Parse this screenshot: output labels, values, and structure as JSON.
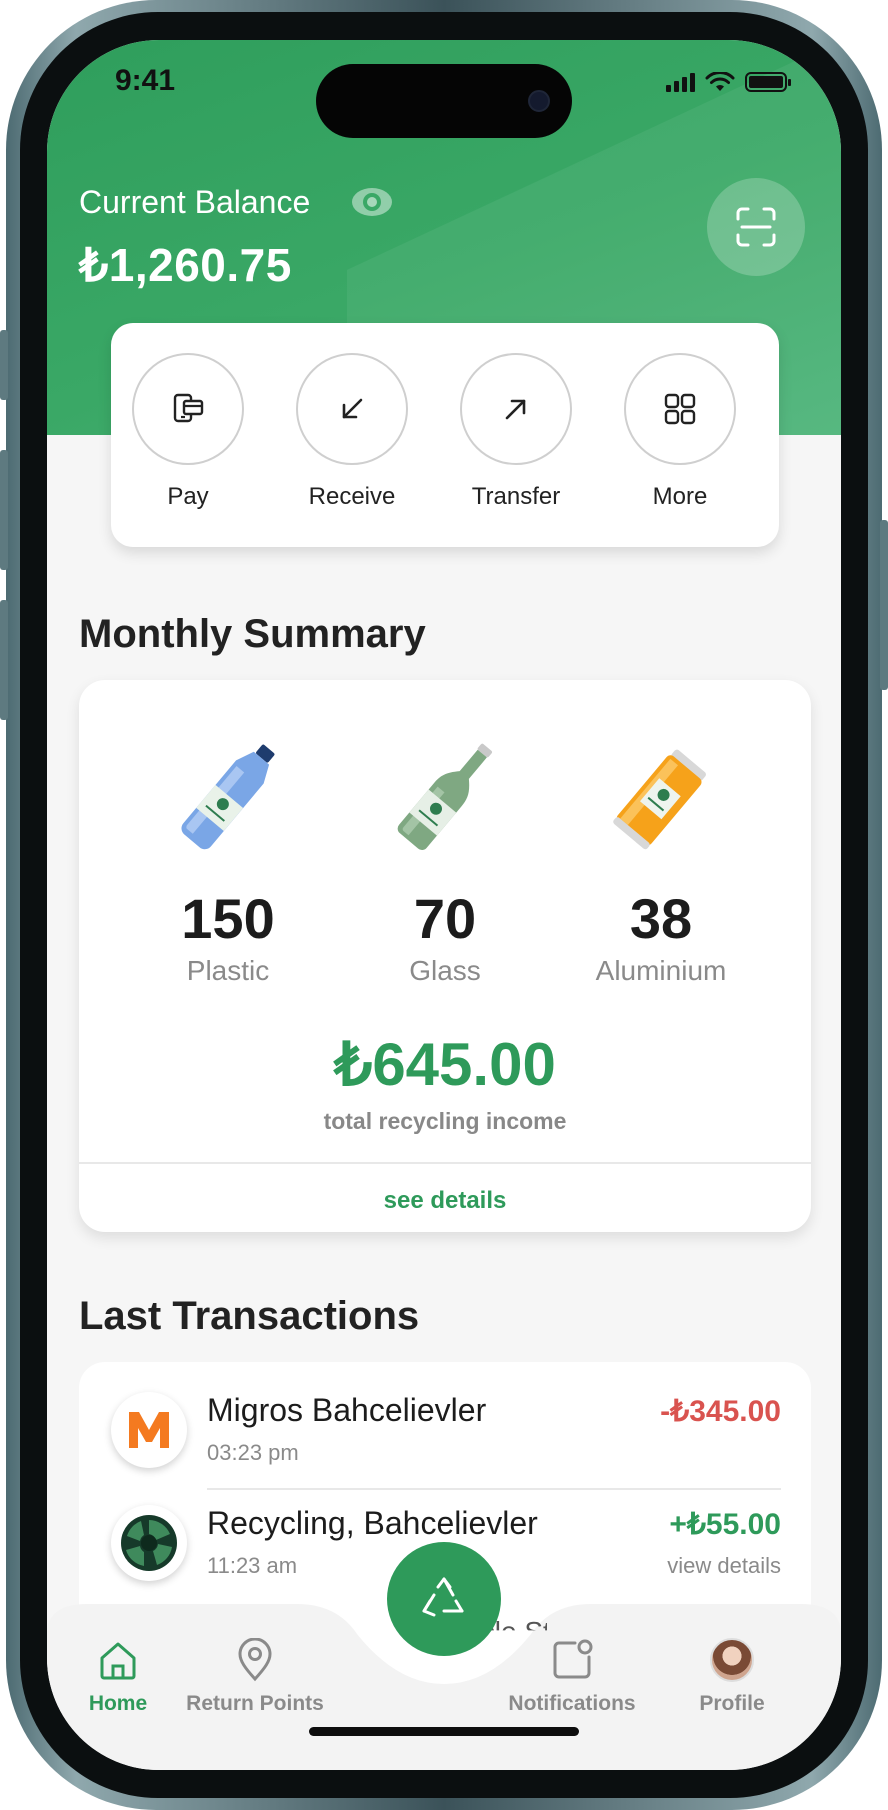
{
  "status": {
    "time": "9:41"
  },
  "balance": {
    "label": "Current Balance",
    "amount": "₺1,260.75"
  },
  "actions": [
    {
      "label": "Pay",
      "icon": "pay-icon"
    },
    {
      "label": "Receive",
      "icon": "arrow-down-left-icon"
    },
    {
      "label": "Transfer",
      "icon": "arrow-up-right-icon"
    },
    {
      "label": "More",
      "icon": "grid-icon"
    }
  ],
  "summary": {
    "title": "Monthly Summary",
    "materials": [
      {
        "count": "150",
        "name": "Plastic",
        "icon": "plastic-bottle-icon",
        "color": "#6e9de0"
      },
      {
        "count": "70",
        "name": "Glass",
        "icon": "glass-bottle-icon",
        "color": "#7fa882"
      },
      {
        "count": "38",
        "name": "Aluminium",
        "icon": "aluminium-can-icon",
        "color": "#f6a21a"
      }
    ],
    "income": "₺645.00",
    "income_label": "total recycling income",
    "see_details": "see details"
  },
  "transactions": {
    "title": "Last Transactions",
    "items": [
      {
        "name": "Migros Bahcelievler",
        "time": "03:23 pm",
        "amount": "-₺345.00",
        "sub": "",
        "amount_color": "#d9534f"
      },
      {
        "name": "Recycling, Bahcelievler",
        "time": "11:23 am",
        "amount": "+₺55.00",
        "sub": "view details",
        "amount_color": "#2e9a5a"
      }
    ]
  },
  "nav": {
    "items": [
      {
        "label": "Home",
        "active": true
      },
      {
        "label": "Return Points",
        "active": false
      },
      {
        "label": "Notifications",
        "active": false
      },
      {
        "label": "Profile",
        "active": false
      }
    ],
    "center_ghost": "Recycle Sto"
  },
  "colors": {
    "brand_green": "#2e9a5a",
    "negative": "#d9534f"
  }
}
